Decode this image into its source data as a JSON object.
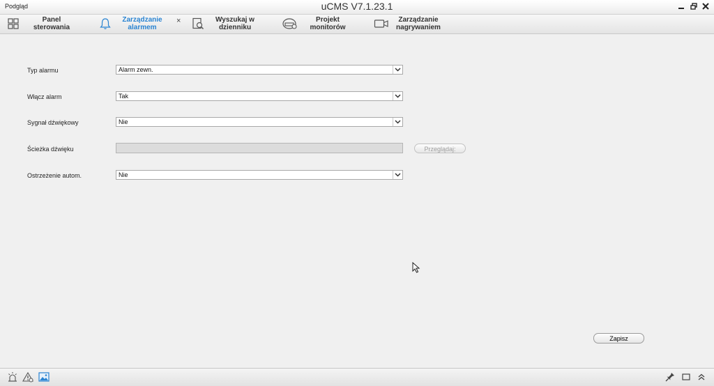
{
  "window": {
    "left_label": "Podgląd",
    "title": "uCMS V7.1.23.1"
  },
  "tabs": [
    {
      "label": "Panel\nsterowania",
      "icon": "grid-icon",
      "active": false
    },
    {
      "label": "Zarządzanie\nalarmem",
      "icon": "bell-icon",
      "active": true,
      "closable": true
    },
    {
      "label": "Wyszukaj w\ndzienniku",
      "icon": "log-search-icon",
      "active": false
    },
    {
      "label": "Projekt\nmonitorów",
      "icon": "monitor-project-icon",
      "active": false
    },
    {
      "label": "Zarządzanie\nnagrywaniem",
      "icon": "camera-icon",
      "active": false
    }
  ],
  "tab_close_glyph": "×",
  "form": {
    "alarm_type": {
      "label": "Typ alarmu",
      "value": "Alarm zewn."
    },
    "enable_alarm": {
      "label": "Włącz alarm",
      "value": "Tak"
    },
    "beep": {
      "label": "Sygnał dźwiękowy",
      "value": "Nie"
    },
    "sound_path": {
      "label": "Ścieżka dźwięku",
      "value": "",
      "browse_label": "Przeglądaj:"
    },
    "auto_warning": {
      "label": "Ostrzeżenie autom.",
      "value": "Nie"
    }
  },
  "save_label": "Zapisz",
  "colors": {
    "accent": "#2a84d2",
    "background": "#f0f0f0"
  }
}
